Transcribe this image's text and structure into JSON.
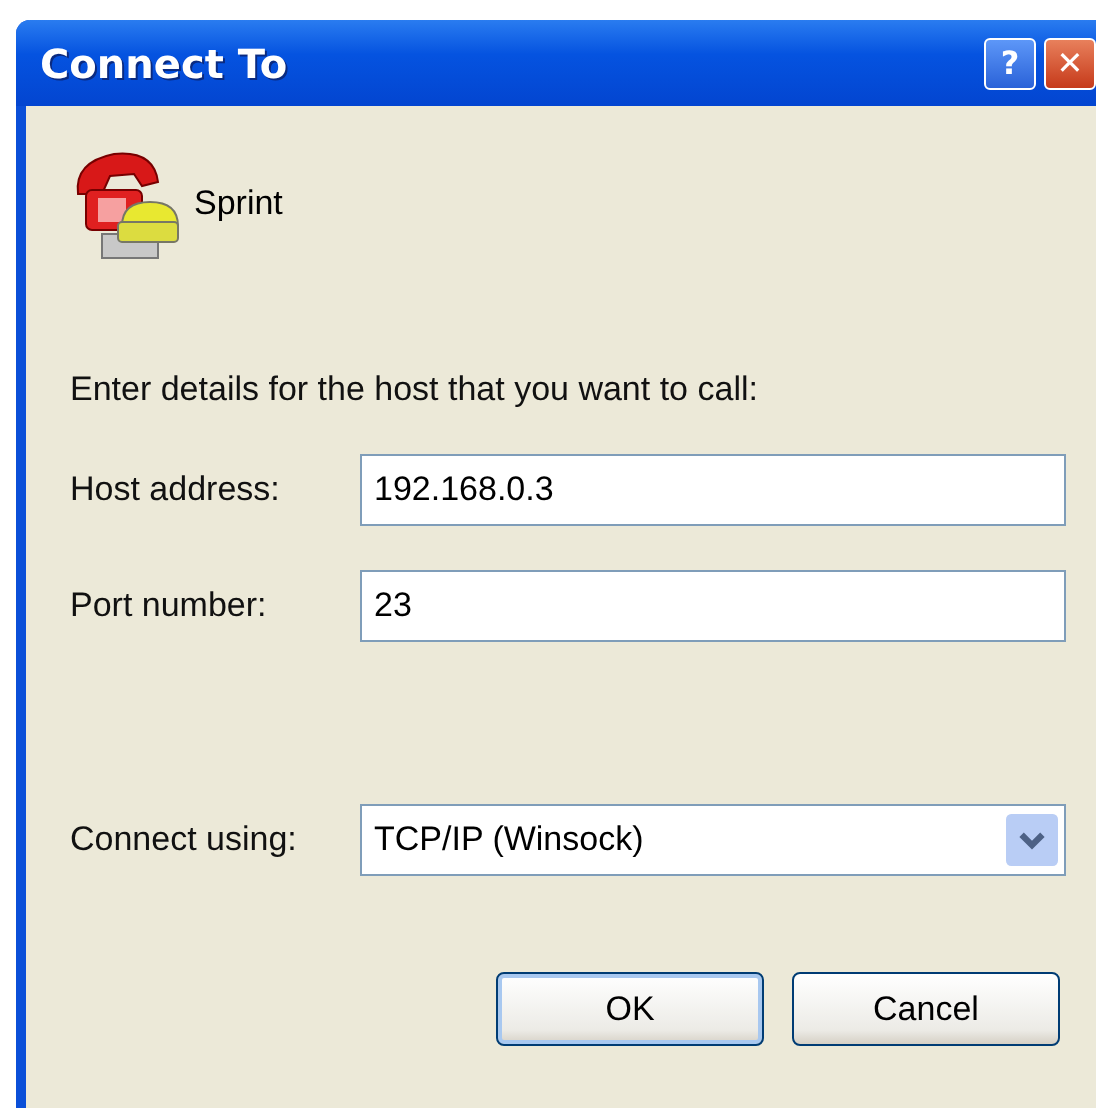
{
  "window": {
    "title": "Connect To",
    "help_button": "?",
    "close_button": "✕"
  },
  "connection": {
    "name": "Sprint"
  },
  "instruction": "Enter details for the host that you want to call:",
  "fields": [
    {
      "kind": "text",
      "label": "Host address:",
      "value": "192.168.0.3"
    },
    {
      "kind": "text",
      "label": "Port number:",
      "value": "23"
    },
    {
      "kind": "dropdown",
      "label": "Connect using:",
      "value": "TCP/IP (Winsock)"
    }
  ],
  "buttons": [
    {
      "label": "OK",
      "default": true
    },
    {
      "label": "Cancel",
      "default": false
    }
  ]
}
